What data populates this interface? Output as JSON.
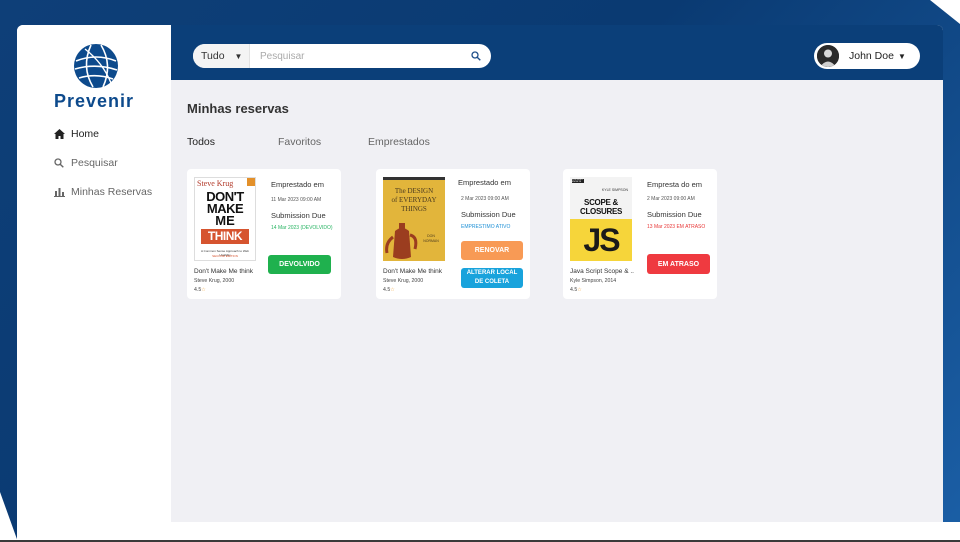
{
  "brand": {
    "name": "Prevenir",
    "color": "#0d4a8c"
  },
  "sidebar": {
    "items": [
      {
        "label": "Home",
        "icon": "home-icon",
        "active": true
      },
      {
        "label": "Pesquisar",
        "icon": "search-icon",
        "active": false
      },
      {
        "label": "Minhas Reservas",
        "icon": "bar-chart-icon",
        "active": false
      }
    ]
  },
  "header": {
    "search": {
      "category": "Tudo",
      "placeholder": "Pesquisar"
    },
    "user": {
      "name": "John Doe"
    }
  },
  "main": {
    "title": "Minhas reservas",
    "tabs": [
      {
        "label": "Todos",
        "active": true
      },
      {
        "label": "Favoritos",
        "active": false
      },
      {
        "label": "Emprestados",
        "active": false
      }
    ],
    "cards": [
      {
        "cover_author": "Steve Krug",
        "cover_lines": [
          "DON'T",
          "MAKE",
          "ME",
          "THINK"
        ],
        "cover_sub": "A Common Sense Approach to Web Usability",
        "cover_edition": "SECOND EDITION",
        "title": "Don't Make Me think",
        "author": "Steve Krug, 2000",
        "rating": "4.5",
        "borrowed_label": "Emprestado em",
        "borrowed_date": "11 Mar 2023 09:00 AM",
        "due_label": "Submission Due",
        "due_status": "14 Mar 2023 (DEVOLVIDO)",
        "due_color": "#28b463",
        "buttons": [
          {
            "label": "DEVOLVIDO",
            "color": "#1fb14e"
          }
        ]
      },
      {
        "cover_title": [
          "The DESIGN",
          "of EVERYDAY",
          "THINGS"
        ],
        "cover_author": "DON NORMAN",
        "title": "Don't Make Me think",
        "author": "Steve Krug, 2000",
        "rating": "4.5",
        "borrowed_label": "Emprestado em",
        "borrowed_date": "2 Mar 2023 09:00 AM",
        "due_label": "Submission Due",
        "due_status": "EMPRESTIMO ATIVO",
        "due_color": "#1e90d6",
        "buttons": [
          {
            "label": "RENOVAR",
            "color": "#f89a55"
          },
          {
            "label": "ALTERAR LOCAL DE COLETA",
            "color": "#19a3dc"
          }
        ]
      },
      {
        "cover_series": "YOU DON'T KNOW JS",
        "cover_author": "KYLE SIMPSON",
        "cover_lines": [
          "SCOPE &",
          "CLOSURES"
        ],
        "cover_js": "JS",
        "title": "Java Script Scope & ..",
        "author": "Kyle Simpson, 2014",
        "rating": "4.5",
        "borrowed_label": "Empresta do em",
        "borrowed_date": "2 Mar 2023 09:00 AM",
        "due_label": "Submission Due",
        "due_status": "13 Mar 2023 EM ATRASO",
        "due_color": "#e83838",
        "buttons": [
          {
            "label": "EM ATRASO",
            "color": "#ef3a40"
          }
        ]
      }
    ]
  }
}
